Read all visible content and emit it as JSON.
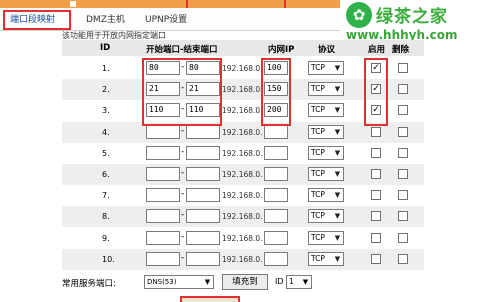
{
  "tabs": [
    {
      "label": "端口段映射",
      "active": true
    },
    {
      "label": "DMZ主机",
      "active": false
    },
    {
      "label": "UPNP设置",
      "active": false
    }
  ],
  "description": "该功能用于开放内网指定端口",
  "watermark": {
    "brand_text": "绿茶之家",
    "url": "www.hhhyh.com"
  },
  "table": {
    "headers": {
      "id": "ID",
      "port_range": "开始端口-结束端口",
      "ip": "内网IP",
      "protocol": "协议",
      "enable": "启用",
      "delete": "删除"
    },
    "ip_prefix": "192.168.0.",
    "rows": [
      {
        "id": "1.",
        "start": "80",
        "end": "80",
        "ip_last": "100",
        "protocol": "TCP",
        "enabled": true,
        "delete": false
      },
      {
        "id": "2.",
        "start": "21",
        "end": "21",
        "ip_last": "150",
        "protocol": "TCP",
        "enabled": true,
        "delete": false
      },
      {
        "id": "3.",
        "start": "110",
        "end": "110",
        "ip_last": "200",
        "protocol": "TCP",
        "enabled": true,
        "delete": false
      },
      {
        "id": "4.",
        "start": "",
        "end": "",
        "ip_last": "",
        "protocol": "TCP",
        "enabled": false,
        "delete": false
      },
      {
        "id": "5.",
        "start": "",
        "end": "",
        "ip_last": "",
        "protocol": "TCP",
        "enabled": false,
        "delete": false
      },
      {
        "id": "6.",
        "start": "",
        "end": "",
        "ip_last": "",
        "protocol": "TCP",
        "enabled": false,
        "delete": false
      },
      {
        "id": "7.",
        "start": "",
        "end": "",
        "ip_last": "",
        "protocol": "TCP",
        "enabled": false,
        "delete": false
      },
      {
        "id": "8.",
        "start": "",
        "end": "",
        "ip_last": "",
        "protocol": "TCP",
        "enabled": false,
        "delete": false
      },
      {
        "id": "9.",
        "start": "",
        "end": "",
        "ip_last": "",
        "protocol": "TCP",
        "enabled": false,
        "delete": false
      },
      {
        "id": "10.",
        "start": "",
        "end": "",
        "ip_last": "",
        "protocol": "TCP",
        "enabled": false,
        "delete": false
      }
    ]
  },
  "bottom": {
    "common_ports_label": "常用服务端口:",
    "service_selected": "DNS(53)",
    "fill_button": "填充到",
    "id_label": "ID",
    "id_selected": "1"
  },
  "colors": {
    "accent_red": "#e03030",
    "top_bar": "#f1a04a",
    "watermark_green": "#3cae3c"
  }
}
